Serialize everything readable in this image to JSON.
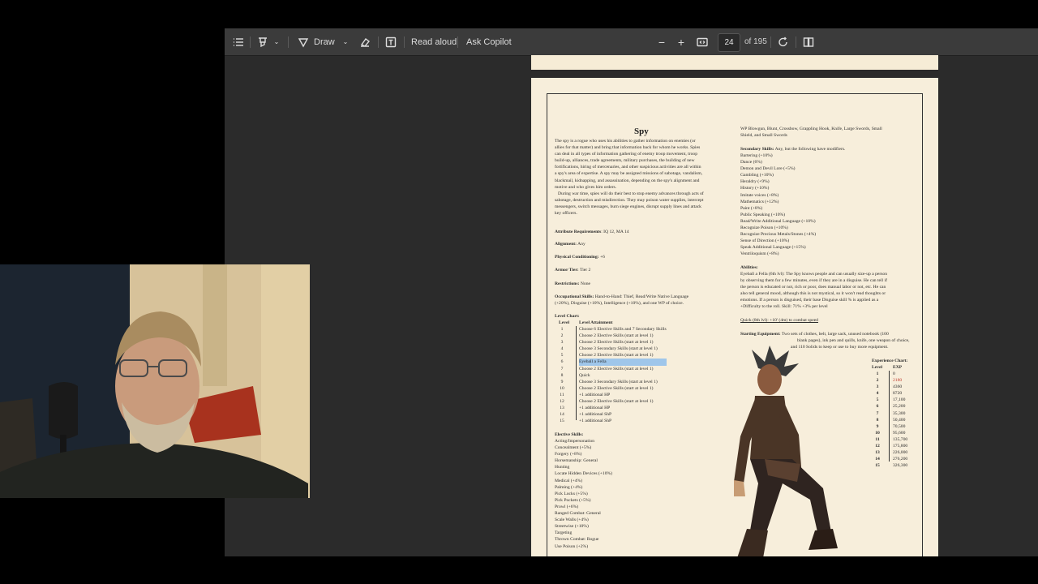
{
  "toolbar": {
    "draw": "Draw",
    "read_aloud": "Read aloud",
    "ask_copilot": "Ask Copilot",
    "page_current": "24",
    "page_total": "of 195"
  },
  "colors": {
    "viewer_bg": "#2b2b2b",
    "toolbar_bg": "#3b3b3b",
    "paper": "#f7eedb",
    "highlight": "#9fc6ea"
  },
  "doc": {
    "title": "Spy",
    "intro": [
      "The spy is a rogue who uses his abilities to gather information on enemies (or",
      "allies for that matter) and bring that information back for whom he works. Spies",
      "can deal in all types of information gathering of enemy troop movement, troop",
      "build-up, alliances, trade agreements, military purchases, the building of new",
      "fortifications, hiring of mercenaries, and other suspicious activities are all within",
      "a spy's area of expertise. A spy may be assigned missions of sabotage, vandalism,",
      "blackmail, kidnapping, and assassination, depending on the spy's alignment and",
      "motive and who gives him orders.",
      "During war time, spies will do their best to stop enemy advances through acts of",
      "sabotage, destruction and misdirection. They may poison water supplies, intercept",
      "messengers, switch messages, burn siege engines, disrupt supply lines and attack",
      "key officers."
    ],
    "attr_label": "Attribute Requirements",
    "attr_value": ": IQ 12, MA 14",
    "align_label": "Alignment:",
    "align_value": " Any",
    "phys_label": "Physical Conditioning:",
    "phys_value": " +6",
    "armor_label": "Armor Tier:",
    "armor_value": " Tier 2",
    "restr_label": "Restrictions:",
    "restr_value": " None",
    "occ_label": "Occupational Skills:",
    "occ_line1": " Hand-to-Hand: Thief, Read/Write Native Language",
    "occ_line2": "(+20%), Disguise (+10%), Intelligence (+10%), and one WP of choice.",
    "level_chart_label": "Level Chart:",
    "level_head": "Level",
    "attain_head": "Level Attainment",
    "levels": [
      "1",
      "2",
      "3",
      "4",
      "5",
      "6",
      "7",
      "8",
      "9",
      "10",
      "11",
      "12",
      "13",
      "14",
      "15"
    ],
    "attainments": [
      "Choose 6 Elective Skills and 7 Secondary Skills",
      "Choose 2 Elective Skills (start at level 1)",
      "Choose 2 Elective Skills (start at level 1)",
      "Choose 3 Secondary Skills (start at level 1)",
      "Choose 2 Elective Skills (start at level 1)",
      "Eyeball a Fella",
      "Choose 2 Elective Skills (start at level 1)",
      "Quick",
      "Choose 3 Secondary Skills (start at level 1)",
      "Choose 2 Elective Skills (start at level 1)",
      "+1 additional HP",
      "Choose 2 Elective Skills (start at level 1)",
      "+1 additional HP",
      "+1 additional ShP",
      "+1 additional ShP"
    ],
    "elective_label": "Elective Skills:",
    "electives": [
      "Acting/Impersonation",
      "Concealment (+5%)",
      "Forgery (+8%)",
      "Horsemanship: General",
      "Hunting",
      "Locate Hidden Devices (+10%)",
      "Medical (+4%)",
      "Palming (+4%)",
      "Pick Locks (+5%)",
      "Pick Pockets (+5%)",
      "Prowl (+6%)",
      "Ranged Combat: General",
      "Scale Walls (+4%)",
      "Streetwise (+10%)",
      "Targeting",
      "Thrown Combat: Rogue",
      "Use Poison (+2%)"
    ],
    "wp_line1": "WP Blowgun, Blunt, Crossbow, Grappling Hook, Knife, Large Swords, Small",
    "wp_line2": "Shield, and Small Swords",
    "secondary_label": "Secondary Skills:",
    "secondary_value": " Any, but the following have modifiers.",
    "secondaries": [
      "Bartering (+10%)",
      "Dance (6%)",
      "Demon and Devil Lore (+5%)",
      "Gambling (+10%)",
      "Heraldry (+9%)",
      "History (+10%)",
      "Imitate voices (+8%)",
      "Mathematics (+12%)",
      "Paint (+8%)",
      "Public Speaking (+10%)",
      "Read/Write Additional Language (+10%)",
      "Recognize Poison (+10%)",
      "Recognize Precious Metals/Stones (+4%)",
      "Sense of Direction (+10%)",
      "Speak Additional Language (+15%)",
      "Ventriloquism (+8%)"
    ],
    "abilities_label": "Abilities:",
    "abilities": [
      "Eyeball a Fella (6th lvl): The Spy knows people and can usually size-up a person",
      "by observing them for a few minutes, even if they are in a disguise. He can tell if",
      "the person is educated or not, rich or poor, does manual labor or not, etc. He can",
      "also tell general mood, although this is not mystical, so it won't read thoughts or",
      "emotions. If a person is disguised, their base Disguise skill % is applied as a",
      "+Difficulty to the roll. Skill: 71% +3% per level"
    ],
    "quick": "Quick (8th lvl): +10' (4m) to combat speed",
    "equip_label": "Starting Equipment:",
    "equip": [
      " Two sets of clothes, belt, large sack, unused notebook (100",
      "blank pages), ink pen and quills, knife, one weapon of choice,",
      "and 110 Solids to keep or use to buy more equipment."
    ],
    "exp_label": "Experience Chart:",
    "exp_level_head": "Level",
    "exp_head": "EXP",
    "exp_levels": [
      "1",
      "2",
      "3",
      "4",
      "5",
      "6",
      "7",
      "8",
      "9",
      "10",
      "11",
      "12",
      "13",
      "14",
      "15"
    ],
    "exp_values": [
      "0",
      "2180",
      "4360",
      "8720",
      "17,100",
      "25,200",
      "35,300",
      "50,400",
      "70,500",
      "95,600",
      "135,700",
      "175,800",
      "226,000",
      "276,200",
      "326,300"
    ]
  }
}
